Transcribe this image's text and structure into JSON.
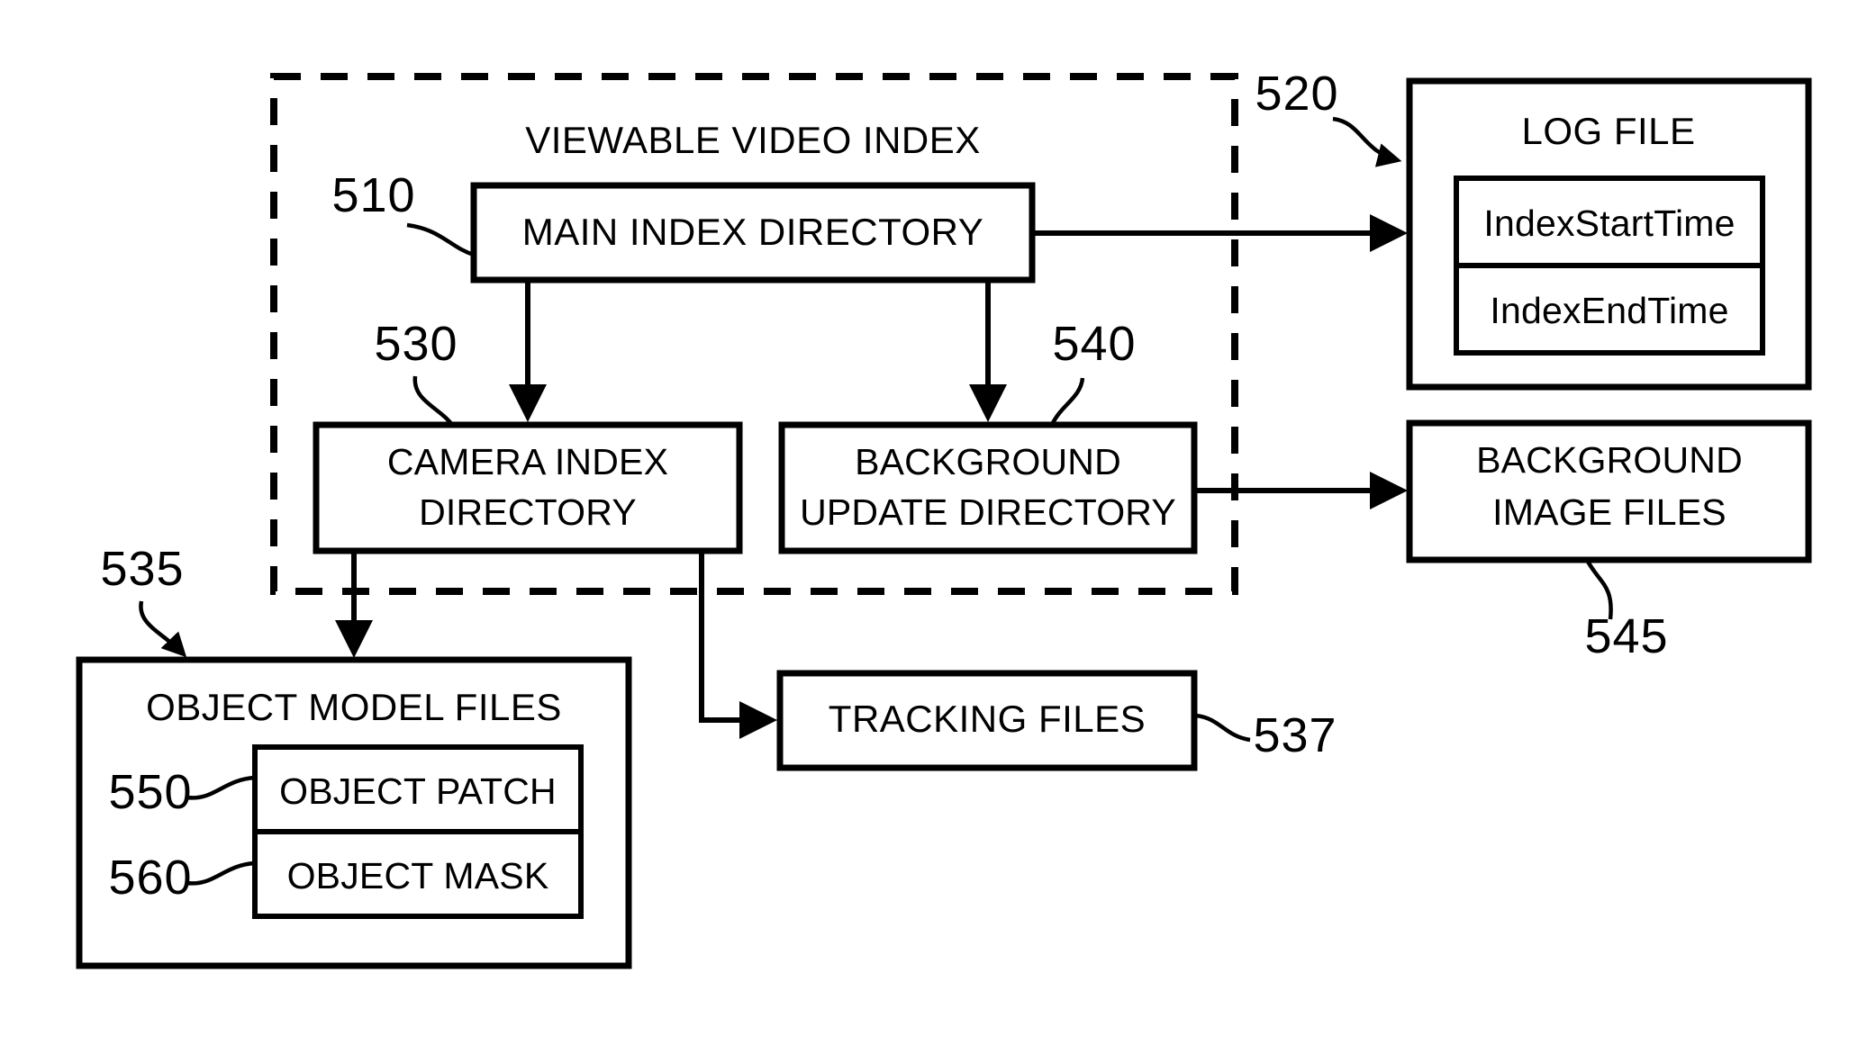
{
  "figure": {
    "type": "patent-block-diagram",
    "group": {
      "title": "VIEWABLE VIDEO INDEX"
    },
    "boxes": {
      "main_index_directory": "MAIN INDEX DIRECTORY",
      "camera_index_directory_line1": "CAMERA INDEX",
      "camera_index_directory_line2": "DIRECTORY",
      "background_update_directory_line1": "BACKGROUND",
      "background_update_directory_line2": "UPDATE DIRECTORY",
      "log_file": "LOG FILE",
      "index_start_time": "IndexStartTime",
      "index_end_time": "IndexEndTime",
      "background_image_files_line1": "BACKGROUND",
      "background_image_files_line2": "IMAGE FILES",
      "object_model_files": "OBJECT MODEL FILES",
      "object_patch": "OBJECT PATCH",
      "object_mask": "OBJECT MASK",
      "tracking_files": "TRACKING FILES"
    },
    "reference_numerals": {
      "main_index_directory": "510",
      "log_file": "520",
      "camera_index_directory": "530",
      "object_model_files": "535",
      "tracking_files": "537",
      "background_update_directory": "540",
      "background_image_files": "545",
      "object_patch": "550",
      "object_mask": "560"
    },
    "colors": {
      "ink": "#000000",
      "paper": "#ffffff"
    }
  }
}
